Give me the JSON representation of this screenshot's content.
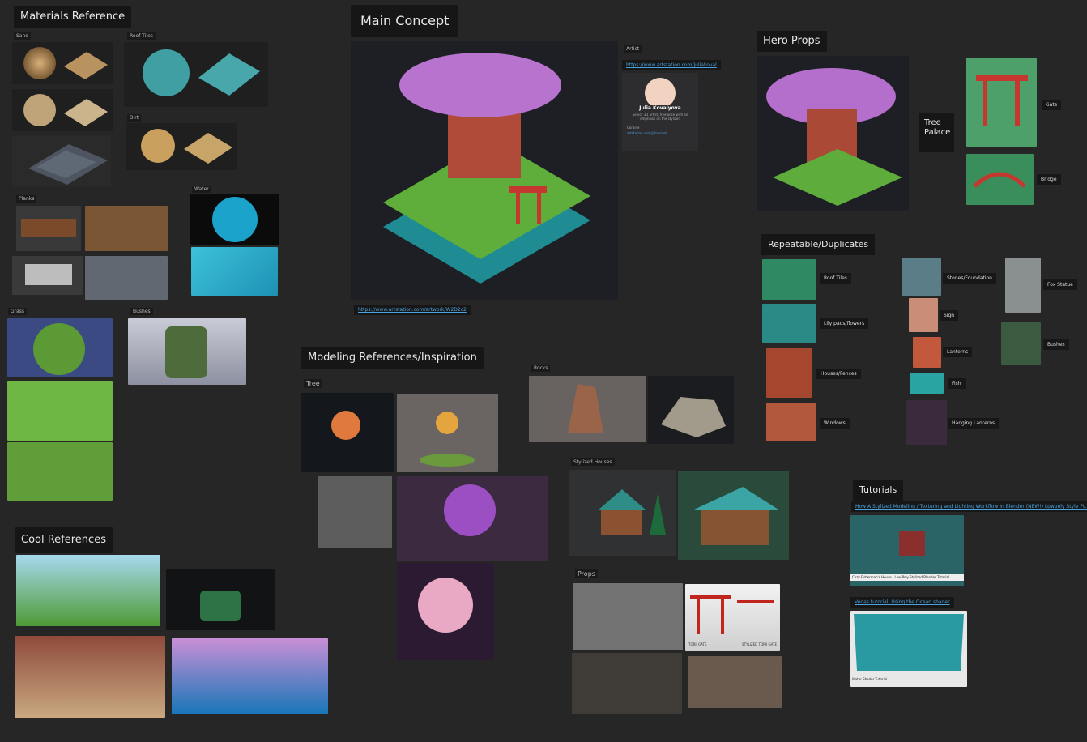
{
  "headings": {
    "materials": "Materials Reference",
    "main_concept": "Main Concept",
    "hero_props": "Hero Props",
    "repeatable": "Repeatable/Duplicates",
    "modeling": "Modeling References/Inspiration",
    "cool": "Cool References",
    "tutorials": "Tutorials"
  },
  "material_tiles": [
    "Sand",
    "Roof Tiles",
    "Dirt",
    "Planks",
    "Water",
    "Grass",
    "Bushes"
  ],
  "main": {
    "artist_label": "Artist",
    "artist_link": "https://www.artstation.com/juliakoval",
    "artist_name": "Julia Kovalyova",
    "artist_bio": "Senior 3D artist, freelance with an emphasis on the stylized",
    "artist_loc": "Ukraine",
    "artist_site": "artstation.com/juliakoval",
    "concept_link": "https://www.artstation.com/artwork/W2D2c2"
  },
  "hero": {
    "tree_palace": "Tree Palace",
    "gate": "Gate",
    "bridge": "Bridge"
  },
  "repeat_items": [
    "Roof Tiles",
    "Lily pads/flowers",
    "Houses/Fences",
    "Windows",
    "Stones/Foundation",
    "Sign",
    "Lanterns",
    "Fish",
    "Fox Statue",
    "Hanging Lanterns",
    "Bushes"
  ],
  "modeling": {
    "tree": "Tree",
    "rocks": "Rocks",
    "stylized_houses": "Stylized Houses",
    "props": "Props",
    "prop_caption_a": "TORII GATE",
    "prop_caption_b": "STYLIZED TORII GATE"
  },
  "tutorials": {
    "video1_title": "How A Stylized Modeling / Texturing and Lighting Workflow In Blender (NEW!) Lowpoly Style Pt.1",
    "video2_title": "Vegas tutorial: Using the Ocean shader",
    "video1_caption": "Cozy Fisherman's House | Low Poly Stylized Blender Tutorial",
    "video2_caption": "Water Shader Tutorial"
  },
  "colors": {
    "board": "#262626",
    "label_bg": "#161616",
    "link": "#4aa3df",
    "accent_pink": "#c77dd6"
  }
}
